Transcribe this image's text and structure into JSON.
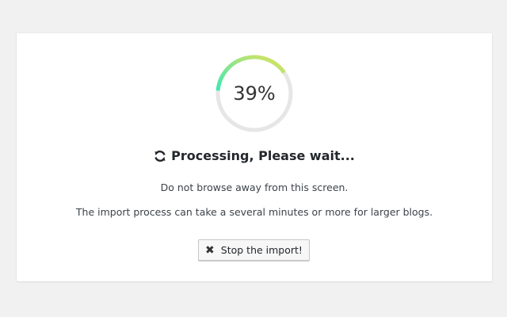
{
  "progress": {
    "value": 0.39,
    "label": "39%",
    "colors": {
      "start": "#3ee8b5",
      "end": "#e2e25a",
      "track": "#e6e6e6"
    }
  },
  "status": {
    "icon": "refresh-icon",
    "text": "Processing, Please wait..."
  },
  "messages": {
    "line1": "Do not browse away from this screen.",
    "line2": "The import process can take a several minutes or more for larger blogs."
  },
  "stop_button": {
    "icon": "close-icon",
    "label": "Stop the import!"
  }
}
